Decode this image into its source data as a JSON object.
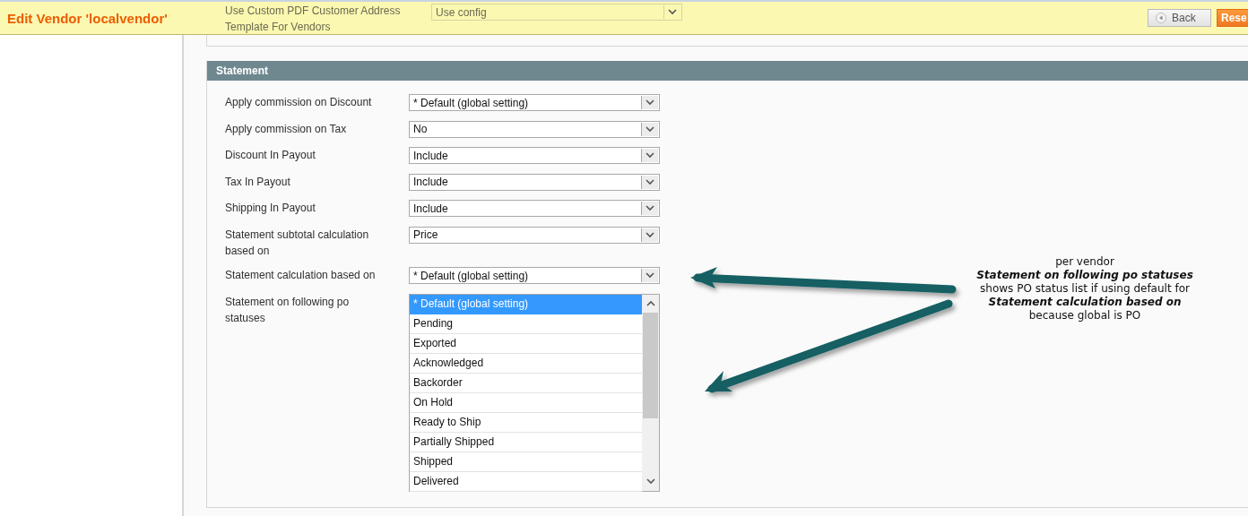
{
  "header": {
    "title": "Edit Vendor 'localvendor'",
    "buttons": [
      {
        "kind": "back",
        "label": "Back"
      },
      {
        "kind": "primary",
        "label": "Rese"
      }
    ]
  },
  "previous_section": {
    "fields": [
      {
        "kind": "select",
        "label": "Use Custom PDF Customer Address Template For Vendors",
        "value": "Use config"
      }
    ]
  },
  "section": {
    "title": "Statement",
    "fields": [
      {
        "kind": "select",
        "label": "Apply commission on Discount",
        "value": "* Default (global setting)"
      },
      {
        "kind": "select",
        "label": "Apply commission on Tax",
        "value": "No"
      },
      {
        "kind": "select",
        "label": "Discount In Payout",
        "value": "Include"
      },
      {
        "kind": "select",
        "label": "Tax In Payout",
        "value": "Include"
      },
      {
        "kind": "select",
        "label": "Shipping In Payout",
        "value": "Include"
      },
      {
        "kind": "select",
        "label": "Statement subtotal calculation based on",
        "value": "Price"
      },
      {
        "kind": "select",
        "label": "Statement calculation based on",
        "value": "* Default (global setting)"
      },
      {
        "kind": "multiselect",
        "label": "Statement on following po statuses",
        "options": [
          {
            "label": "* Default (global setting)",
            "selected": true
          },
          {
            "label": "Pending",
            "selected": false
          },
          {
            "label": "Exported",
            "selected": false
          },
          {
            "label": "Acknowledged",
            "selected": false
          },
          {
            "label": "Backorder",
            "selected": false
          },
          {
            "label": "On Hold",
            "selected": false
          },
          {
            "label": "Ready to Ship",
            "selected": false
          },
          {
            "label": "Partially Shipped",
            "selected": false
          },
          {
            "label": "Shipped",
            "selected": false
          },
          {
            "label": "Delivered",
            "selected": false
          }
        ]
      }
    ]
  },
  "annotation": {
    "lines": [
      {
        "kind": "plain",
        "text": "per vendor"
      },
      {
        "kind": "emphasis",
        "text": "Statement on following po statuses"
      },
      {
        "kind": "plain",
        "text": "shows PO status list if using default for"
      },
      {
        "kind": "emphasis",
        "text": "Statement calculation based on"
      },
      {
        "kind": "plain",
        "text": "because global is PO"
      }
    ]
  }
}
